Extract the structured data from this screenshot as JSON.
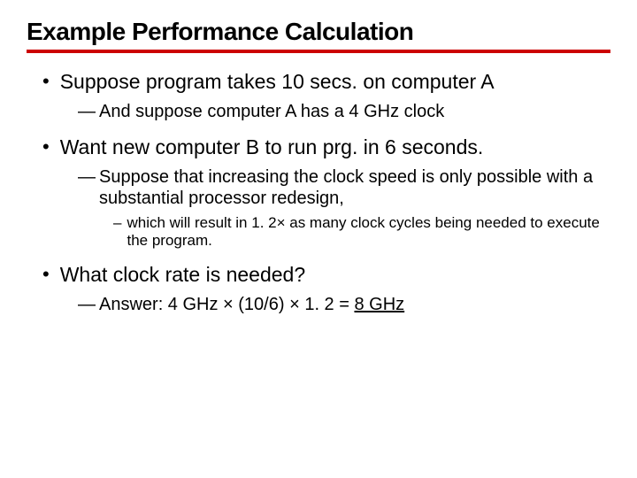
{
  "title": "Example Performance Calculation",
  "b1": {
    "text": "Suppose program takes 10 secs. on computer A"
  },
  "b1a": {
    "text": "And suppose computer A has a 4 GHz clock"
  },
  "b2": {
    "text": "Want new computer B to run prg. in 6 seconds."
  },
  "b2a": {
    "text": "Suppose that increasing the clock speed is only possible with a substantial processor redesign,"
  },
  "b2a1": {
    "text": "which will result in 1. 2× as many clock cycles being needed to execute the program."
  },
  "b3": {
    "text": "What clock rate is needed?"
  },
  "b3a": {
    "prefix": " Answer: 4 GHz × (10/6) × 1. 2 = ",
    "result": "8 GHz"
  }
}
